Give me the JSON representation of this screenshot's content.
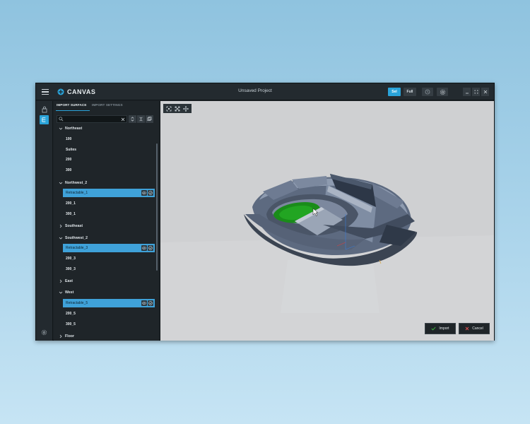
{
  "app": {
    "brand": "CANVAS",
    "title": "Unsaved Project",
    "mode_buttons": {
      "sel": "Sel",
      "full": "Full"
    }
  },
  "panel": {
    "tabs": [
      {
        "label": "IMPORT SURFACE",
        "active": true
      },
      {
        "label": "IMPORT SETTINGS",
        "active": false
      }
    ],
    "search": {
      "value": "",
      "placeholder": ""
    },
    "tree": [
      {
        "label": "Northeast",
        "expanded": true
      },
      {
        "label": "100"
      },
      {
        "label": "Suites"
      },
      {
        "label": "200"
      },
      {
        "label": "300"
      },
      {
        "label": "Northwest_2",
        "expanded": true
      },
      {
        "label": "Retractable_1",
        "selected": true
      },
      {
        "label": "200_1"
      },
      {
        "label": "300_1"
      },
      {
        "label": "Southeast",
        "expanded": false
      },
      {
        "label": "Southwest_2",
        "expanded": true
      },
      {
        "label": "Retractable_3",
        "selected": true
      },
      {
        "label": "200_3"
      },
      {
        "label": "300_3"
      },
      {
        "label": "East",
        "expanded": false
      },
      {
        "label": "West",
        "expanded": true
      },
      {
        "label": "Retractable_5",
        "selected": true
      },
      {
        "label": "200_5"
      },
      {
        "label": "300_5"
      },
      {
        "label": "Floor",
        "expanded": false
      }
    ]
  },
  "footer": {
    "import_label": "Import",
    "cancel_label": "Cancel"
  },
  "colors": {
    "accent": "#2aa3d9",
    "selection": "#3fa2d9",
    "field": "#1a8c1a",
    "viewport_bg": "#cfd0d2"
  }
}
